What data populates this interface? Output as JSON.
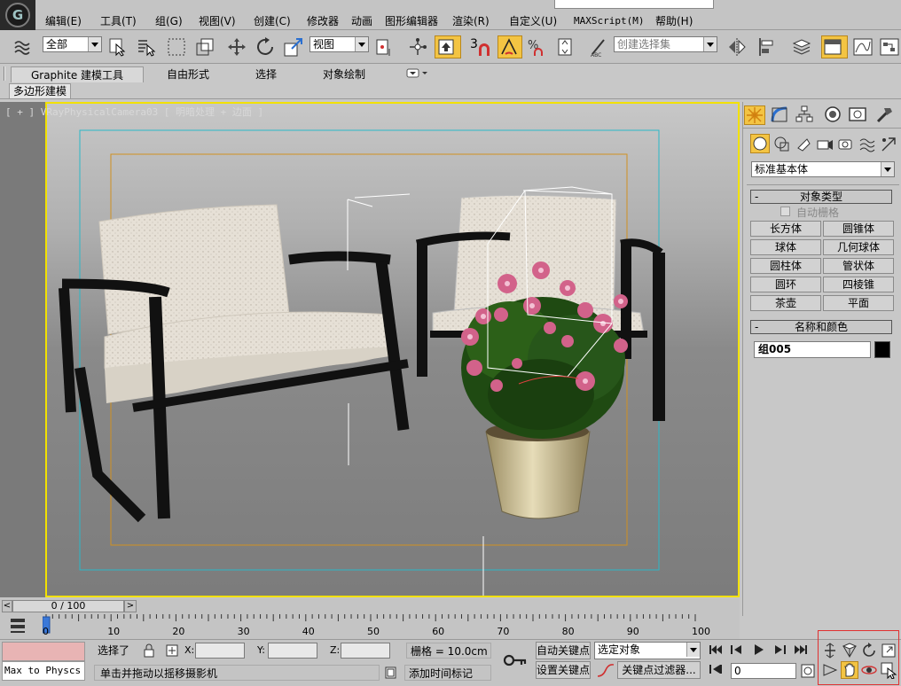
{
  "menu": {
    "items": [
      "编辑(E)",
      "工具(T)",
      "组(G)",
      "视图(V)",
      "创建(C)",
      "修改器",
      "动画",
      "图形编辑器",
      "渲染(R)",
      "自定义(U)",
      "MAXScript(M)",
      "帮助(H)"
    ]
  },
  "toolbar": {
    "selection_filter": "全部",
    "reference_coord": "视图",
    "snap_number": "3",
    "named_selection_placeholder": "创建选择集"
  },
  "ribbon": {
    "tabs": [
      "Graphite 建模工具",
      "自由形式",
      "选择",
      "对象绘制"
    ],
    "active_sub": "多边形建模"
  },
  "viewport": {
    "label": "[ + ] VRayPhysicalCamera03 [ 明暗处理 + 边面 ]"
  },
  "cmdpanel": {
    "category_dropdown": "标准基本体",
    "object_type_title": "对象类型",
    "autogrid_label": "自动栅格",
    "object_buttons": [
      "长方体",
      "圆锥体",
      "球体",
      "几何球体",
      "圆柱体",
      "管状体",
      "圆环",
      "四棱锥",
      "茶壶",
      "平面"
    ],
    "name_color_title": "名称和颜色",
    "object_name": "组005",
    "object_color": "#000000"
  },
  "timeline": {
    "frame_display": "0 / 100",
    "ticks": [
      "0",
      "10",
      "20",
      "30",
      "40",
      "50",
      "60",
      "70",
      "80",
      "90",
      "100"
    ]
  },
  "status": {
    "maxscript_text": "Max to Physcs (",
    "selected_text": "选择了",
    "x_label": "X:",
    "y_label": "Y:",
    "z_label": "Z:",
    "grid_text": "栅格 = 10.0cm",
    "prompt_text": "单击并拖动以摇移摄影机",
    "add_time_tag": "添加时间标记",
    "auto_key": "自动关键点",
    "set_key": "设置关键点",
    "key_mode_select": "选定对象",
    "key_filters": "关键点过滤器...",
    "current_frame": "0"
  },
  "colors": {
    "active_viewport": "#f2e100",
    "safe_frame_outer": "#2ab8c8",
    "safe_frame_inner": "#d09020",
    "highlight_box": "#e03030"
  }
}
